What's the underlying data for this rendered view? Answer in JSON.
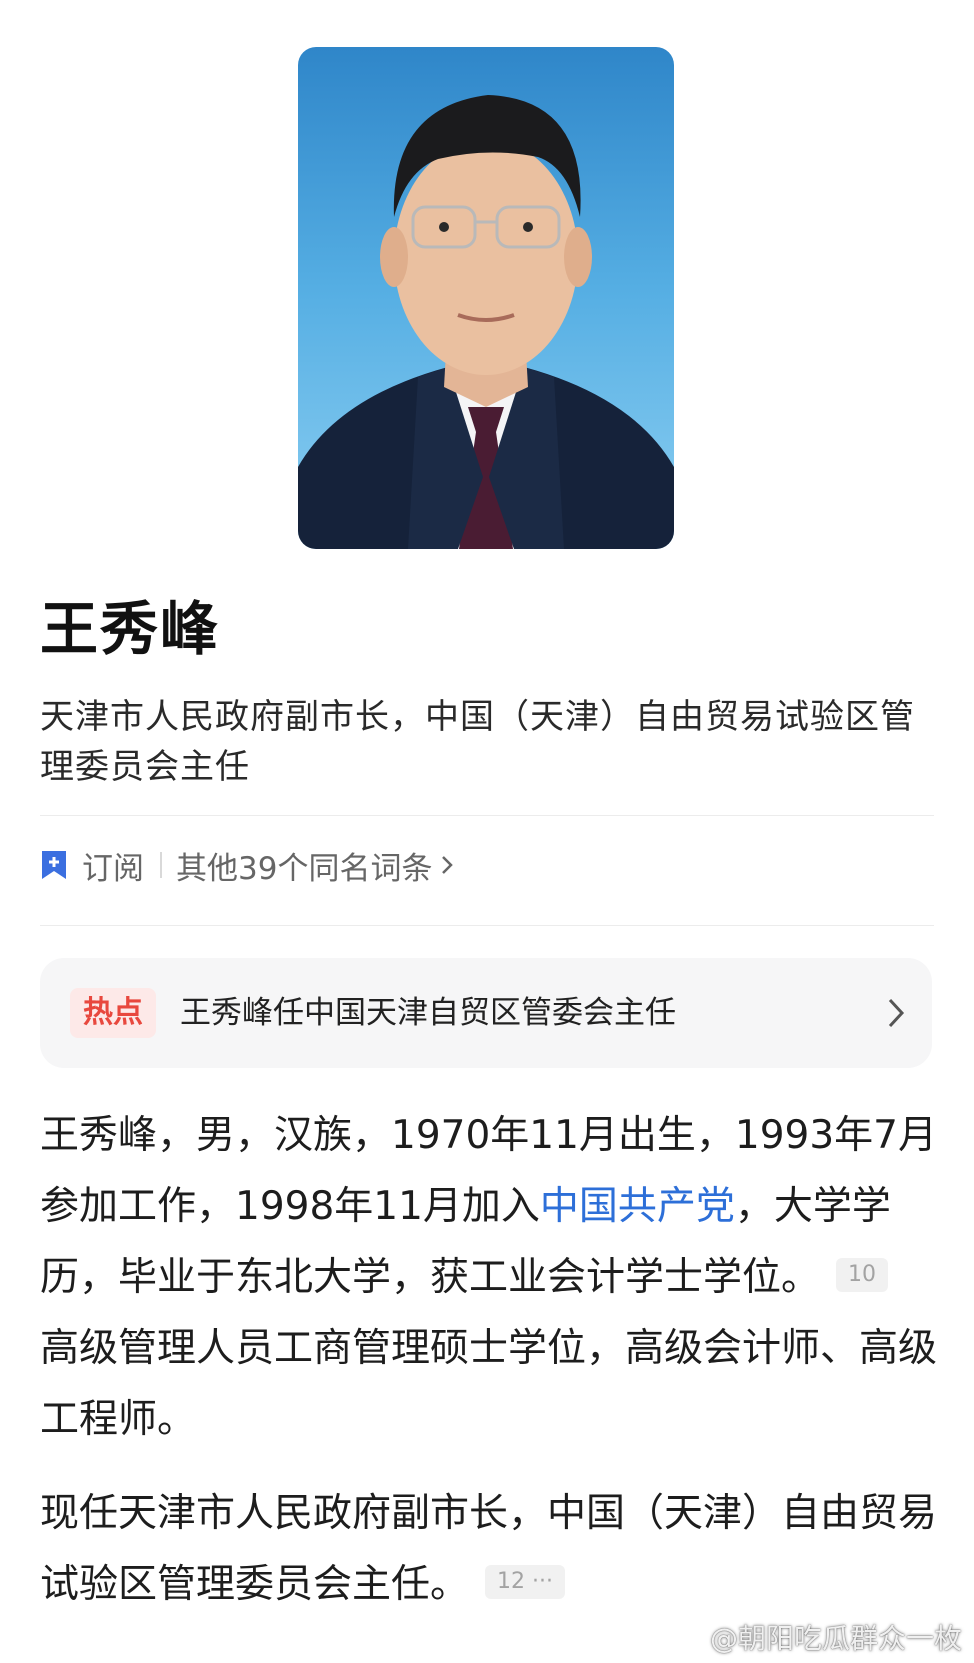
{
  "profile": {
    "name": "王秀峰",
    "subtitle": "天津市人民政府副市长，中国（天津）自由贸易试验区管理委员会主任"
  },
  "actions": {
    "subscribe_label": "订阅",
    "same_name_label": "其他39个同名词条"
  },
  "hot": {
    "tag": "热点",
    "headline": "王秀峰任中国天津自贸区管委会主任"
  },
  "intro": {
    "part1": "王秀峰，男，汉族，1970年11月出生，1993年7月参加工作，1998年11月加入",
    "link": "中国共产党",
    "part2": "，大学学历，毕业于东北大学，获工业会计学士学位。",
    "ref1": "10",
    "part3": "高级管理人员工商管理硕士学位，高级会计师、高级工程师。"
  },
  "current": {
    "text": "现任天津市人民政府副市长，中国（天津）自由贸易试验区管理委员会主任。",
    "ref": "12 ···"
  },
  "watermark": "@朝阳吃瓜群众一枚",
  "colors": {
    "link": "#2d6fd8",
    "hot_tag": "#e8483e",
    "bookmark": "#3b6fe0"
  }
}
